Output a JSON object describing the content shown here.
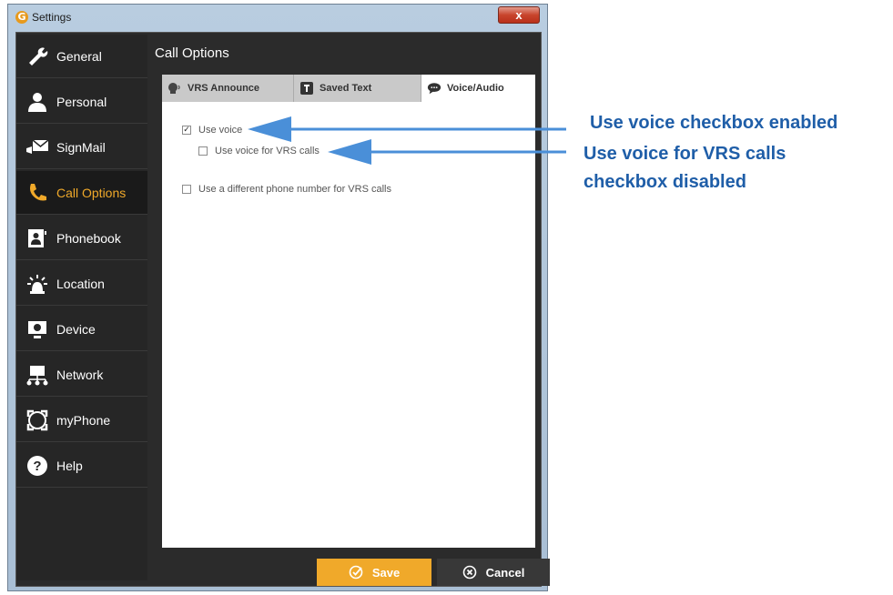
{
  "window": {
    "title": "Settings",
    "close_label": "x"
  },
  "sidebar": {
    "items": [
      {
        "label": "General",
        "icon": "wrench-icon"
      },
      {
        "label": "Personal",
        "icon": "person-icon"
      },
      {
        "label": "SignMail",
        "icon": "signmail-icon"
      },
      {
        "label": "Call Options",
        "icon": "call-options-icon",
        "active": true
      },
      {
        "label": "Phonebook",
        "icon": "phonebook-icon"
      },
      {
        "label": "Location",
        "icon": "location-icon"
      },
      {
        "label": "Device",
        "icon": "device-icon"
      },
      {
        "label": "Network",
        "icon": "network-icon"
      },
      {
        "label": "myPhone",
        "icon": "myphone-icon"
      },
      {
        "label": "Help",
        "icon": "help-icon"
      }
    ]
  },
  "main": {
    "title": "Call Options",
    "tabs": [
      {
        "label": "VRS Announce",
        "icon": "vrs-announce-icon"
      },
      {
        "label": "Saved Text",
        "icon": "saved-text-icon"
      },
      {
        "label": "Voice/Audio",
        "icon": "speech-bubble-icon",
        "active": true
      }
    ],
    "options": {
      "use_voice": {
        "label": "Use voice",
        "checked": true
      },
      "use_voice_vrs": {
        "label": "Use voice for VRS calls",
        "checked": false
      },
      "different_number": {
        "label": "Use a different phone number for VRS calls",
        "checked": false
      }
    }
  },
  "footer": {
    "save_label": "Save",
    "cancel_label": "Cancel"
  },
  "annotations": {
    "callout_1": "Use voice checkbox enabled",
    "callout_2_line1": "Use voice for VRS calls",
    "callout_2_line2": "checkbox disabled"
  },
  "colors": {
    "accent": "#f0a92a",
    "callout": "#1f5ea8",
    "arrow": "#4a8fd8"
  }
}
